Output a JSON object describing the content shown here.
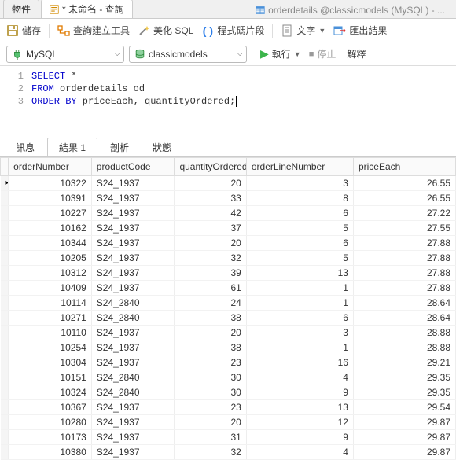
{
  "topTabs": {
    "objects": "物件",
    "queryTitle": "* 未命名 - 查詢",
    "rightTab": "orderdetails @classicmodels (MySQL) - ..."
  },
  "toolbar": {
    "save": "儲存",
    "queryBuilder": "查詢建立工具",
    "beautify": "美化 SQL",
    "snippet": "程式碼片段",
    "text": "文字",
    "export": "匯出結果"
  },
  "conn": {
    "server": "MySQL",
    "database": "classicmodels"
  },
  "run": {
    "execute": "執行",
    "stop": "停止",
    "explain": "解釋"
  },
  "sql": {
    "lines": [
      {
        "n": "1",
        "kw1": "SELECT",
        "rest": " *"
      },
      {
        "n": "2",
        "kw1": "FROM",
        "rest": " orderdetails od"
      },
      {
        "n": "3",
        "kw1": "ORDER BY",
        "rest": " priceEach, quantityOrdered;"
      }
    ]
  },
  "resultTabs": {
    "messages": "訊息",
    "result1": "結果 1",
    "profile": "剖析",
    "status": "狀態"
  },
  "columns": [
    "orderNumber",
    "productCode",
    "quantityOrdered",
    "orderLineNumber",
    "priceEach"
  ],
  "chart_data": {
    "type": "table",
    "title": "orderdetails",
    "columns": [
      "orderNumber",
      "productCode",
      "quantityOrdered",
      "orderLineNumber",
      "priceEach"
    ],
    "rows": [
      [
        10322,
        "S24_1937",
        20,
        3,
        26.55
      ],
      [
        10391,
        "S24_1937",
        33,
        8,
        26.55
      ],
      [
        10227,
        "S24_1937",
        42,
        6,
        27.22
      ],
      [
        10162,
        "S24_1937",
        37,
        5,
        27.55
      ],
      [
        10344,
        "S24_1937",
        20,
        6,
        27.88
      ],
      [
        10205,
        "S24_1937",
        32,
        5,
        27.88
      ],
      [
        10312,
        "S24_1937",
        39,
        13,
        27.88
      ],
      [
        10409,
        "S24_1937",
        61,
        1,
        27.88
      ],
      [
        10114,
        "S24_2840",
        24,
        1,
        28.64
      ],
      [
        10271,
        "S24_2840",
        38,
        6,
        28.64
      ],
      [
        10110,
        "S24_1937",
        20,
        3,
        28.88
      ],
      [
        10254,
        "S24_1937",
        38,
        1,
        28.88
      ],
      [
        10304,
        "S24_1937",
        23,
        16,
        29.21
      ],
      [
        10151,
        "S24_2840",
        30,
        4,
        29.35
      ],
      [
        10324,
        "S24_2840",
        30,
        9,
        29.35
      ],
      [
        10367,
        "S24_1937",
        23,
        13,
        29.54
      ],
      [
        10280,
        "S24_1937",
        20,
        12,
        29.87
      ],
      [
        10173,
        "S24_1937",
        31,
        9,
        29.87
      ],
      [
        10380,
        "S24_1937",
        32,
        4,
        29.87
      ]
    ]
  }
}
